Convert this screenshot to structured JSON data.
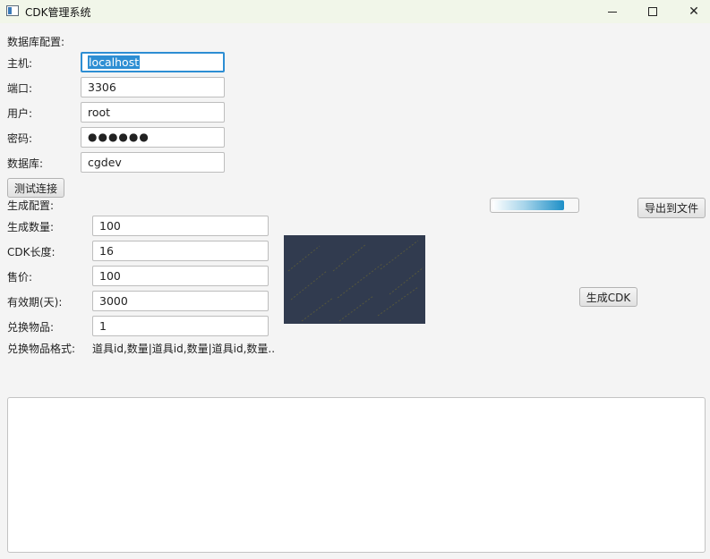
{
  "window": {
    "title": "CDK管理系统",
    "minimize_glyph": "minimize-icon",
    "maximize_glyph": "maximize-icon",
    "close_glyph": "✕"
  },
  "db": {
    "section_label": "数据库配置:",
    "host_label": "主机:",
    "host_value": "localhost",
    "port_label": "端口:",
    "port_value": "3306",
    "user_label": "用户:",
    "user_value": "root",
    "password_label": "密码:",
    "password_mask": "●●●●●●",
    "database_label": "数据库:",
    "database_value": "cgdev",
    "test_button": "测试连接"
  },
  "gen": {
    "section_label": "生成配置:",
    "count_label": "生成数量:",
    "count_value": "100",
    "length_label": "CDK长度:",
    "length_value": "16",
    "price_label": "售价:",
    "price_value": "100",
    "validity_label": "有效期(天):",
    "validity_value": "3000",
    "item_label": "兑换物品:",
    "item_value": "1",
    "format_label": "兑换物品格式:",
    "format_value": "道具id,数量|道具id,数量|道具id,数量..",
    "generate_button": "生成CDK",
    "export_button": "导出到文件"
  },
  "progress": {
    "value": 0.85
  },
  "output": {
    "text": ""
  },
  "colors": {
    "accent": "#2d8ed3",
    "titlebar": "#f1f6e9",
    "preview_bg": "#313b4f"
  }
}
